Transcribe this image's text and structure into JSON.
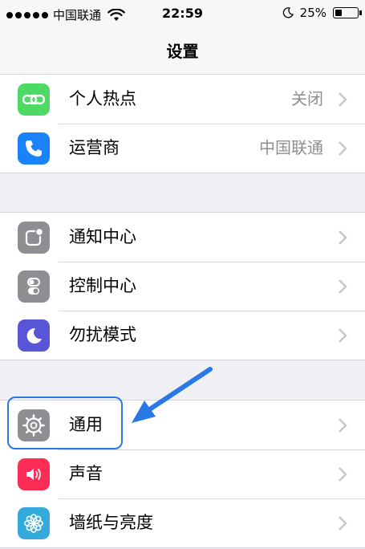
{
  "status_bar": {
    "carrier": "中国联通",
    "time": "22:59",
    "battery_percent": "25%",
    "battery_level": 0.25,
    "signal_dots": 5,
    "icons": [
      "signal-dots",
      "wifi-icon",
      "moon-icon",
      "battery-icon"
    ]
  },
  "nav": {
    "title": "设置"
  },
  "groups": [
    {
      "items": [
        {
          "label": "个人热点",
          "value": "关闭",
          "icon": "hotspot-icon",
          "icon_color": "#4cd964"
        },
        {
          "label": "运营商",
          "value": "中国联通",
          "icon": "phone-icon",
          "icon_color": "#1a82fb"
        }
      ]
    },
    {
      "items": [
        {
          "label": "通知中心",
          "icon": "notification-center-icon",
          "icon_color": "#8e8e93"
        },
        {
          "label": "控制中心",
          "icon": "control-center-icon",
          "icon_color": "#8e8e93"
        },
        {
          "label": "勿扰模式",
          "icon": "moon-icon",
          "icon_color": "#5856d6"
        }
      ]
    },
    {
      "items": [
        {
          "label": "通用",
          "icon": "gear-icon",
          "icon_color": "#8e8e93"
        },
        {
          "label": "声音",
          "icon": "speaker-icon",
          "icon_color": "#ff2d55"
        },
        {
          "label": "墙纸与亮度",
          "icon": "wallpaper-icon",
          "icon_color": "#34aadc"
        }
      ]
    }
  ],
  "annotation": {
    "highlight_color": "#2a78e4",
    "highlighted_item": "通用"
  }
}
